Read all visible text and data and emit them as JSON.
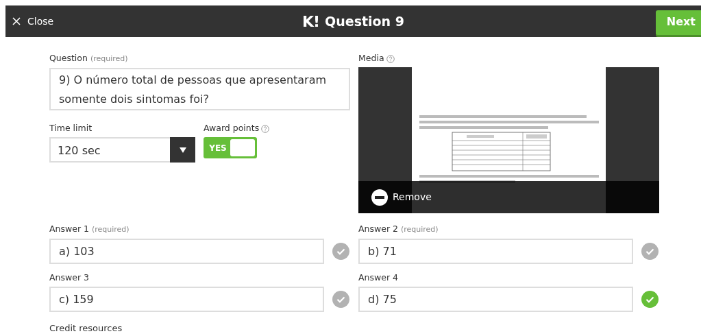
{
  "header": {
    "close": "Close",
    "logo": "K!",
    "title": "Question 9",
    "next": "Next"
  },
  "question": {
    "label": "Question",
    "hint": "(required)",
    "value": "9) O número total de pessoas que apresentaram somente dois sintomas foi?"
  },
  "time_limit": {
    "label": "Time limit",
    "value": "120 sec"
  },
  "award_points": {
    "label": "Award points",
    "on": true,
    "state_label": "YES"
  },
  "media": {
    "label": "Media",
    "kind": "picture",
    "remove": "Remove"
  },
  "answers": [
    {
      "label": "Answer 1",
      "hint": "(required)",
      "value": "a) 103",
      "correct": false
    },
    {
      "label": "Answer 2",
      "hint": "(required)",
      "value": "b) 71",
      "correct": false
    },
    {
      "label": "Answer 3",
      "value": "c) 159",
      "correct": false
    },
    {
      "label": "Answer 4",
      "value": "d) 75",
      "correct": true
    }
  ],
  "credit_resources": "Credit resources"
}
